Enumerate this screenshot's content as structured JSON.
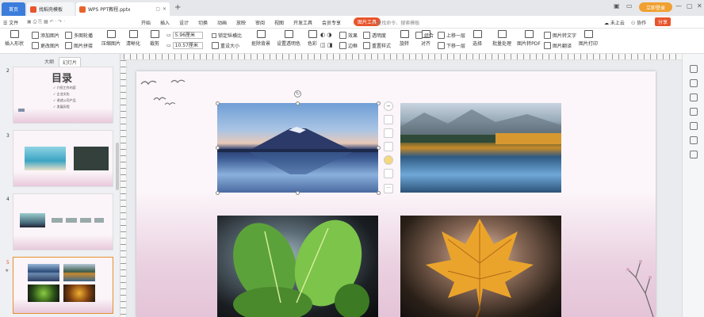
{
  "titlebar": {
    "home_tab": "首页",
    "template_tab": "找稻壳模板",
    "doc_tab": "WPS PPT教程.pptx",
    "login": "立即登录",
    "win_icons": [
      "▣",
      "▭",
      "—",
      "▢",
      "✕"
    ]
  },
  "menubar": {
    "file": "☰ 文件",
    "items": [
      "开始",
      "插入",
      "设计",
      "切换",
      "动画",
      "放映",
      "审阅",
      "视图",
      "开发工具",
      "会员专享"
    ],
    "active_tab": "图片工具",
    "search": "查找命令、搜索模板",
    "right": [
      "未上云",
      "协作",
      "分享"
    ]
  },
  "toolbar": {
    "insert_shape": "插入形状",
    "add_image": "添加图片",
    "multi_crop": "多图轮播",
    "change_image": "更改图片",
    "image_concat": "图片拼接",
    "compress": "压缩图片",
    "sharpen": "清晰化",
    "crop": "裁剪",
    "height": "5.96厘米",
    "width": "10.57厘米",
    "lock_ratio": "锁定纵横比",
    "reset_size": "重设大小",
    "remove_bg": "抠除背景",
    "transparent": "设置透明色",
    "color": "色彩",
    "effects": "效果",
    "border": "边框",
    "reset_style": "重置样式",
    "opacity": "透明度",
    "rotate": "旋转",
    "align": "对齐",
    "group": "组合",
    "bring_up": "上移一层",
    "send_down": "下移一层",
    "select": "选择",
    "batch": "批量处理",
    "img_pdf": "图片转PDF",
    "img_text": "图片转文字",
    "img_translate": "图片翻译",
    "img_print": "图片打印"
  },
  "sidepanel": {
    "tabs": [
      "大纲",
      "幻灯片"
    ],
    "slides": [
      {
        "num": "2",
        "title": "目录",
        "items": [
          "✓ 介绍工作内容",
          "✓ 企业文化",
          "✓ 讲述公司产品",
          "✓ 发展历程"
        ]
      },
      {
        "num": "3"
      },
      {
        "num": "4"
      },
      {
        "num": "5"
      }
    ]
  },
  "colors": {
    "accent": "#e8542c",
    "home_tab": "#3c7ddc",
    "login": "#f0a030"
  }
}
